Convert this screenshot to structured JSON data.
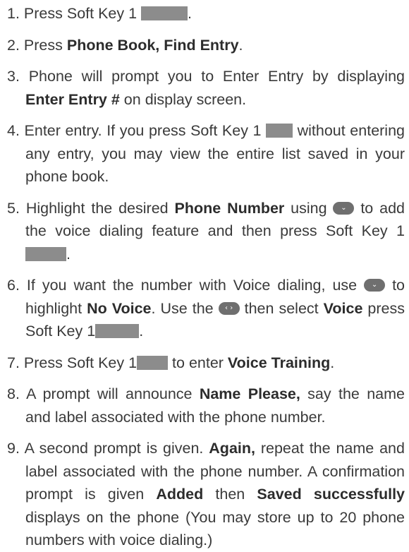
{
  "steps": [
    {
      "num": "1.",
      "parts": [
        {
          "t": "text",
          "v": "Press Soft Key 1 "
        },
        {
          "t": "key",
          "w": "w66"
        },
        {
          "t": "text",
          "v": "."
        }
      ]
    },
    {
      "num": "2.",
      "parts": [
        {
          "t": "text",
          "v": "Press "
        },
        {
          "t": "bold",
          "v": "Phone Book, Find Entry"
        },
        {
          "t": "text",
          "v": "."
        }
      ]
    },
    {
      "num": "3.",
      "parts": [
        {
          "t": "text",
          "v": "Phone will prompt you to Enter Entry by displaying "
        },
        {
          "t": "bold",
          "v": "Enter Entry #"
        },
        {
          "t": "text",
          "v": " on display screen."
        }
      ]
    },
    {
      "num": "4.",
      "parts": [
        {
          "t": "text",
          "v": "Enter entry. If you press Soft Key 1 "
        },
        {
          "t": "key",
          "w": "w38"
        },
        {
          "t": "text",
          "v": " without entering any entry, you may view the entire list saved in your phone book."
        }
      ]
    },
    {
      "num": "5.",
      "parts": [
        {
          "t": "text",
          "v": "Highlight the desired "
        },
        {
          "t": "bold",
          "v": "Phone Number"
        },
        {
          "t": "text",
          "v": " using "
        },
        {
          "t": "nav",
          "icon": "nav-down-icon",
          "glyph": "⌄"
        },
        {
          "t": "text",
          "v": " to add the voice dialing feature and then press Soft Key 1"
        },
        {
          "t": "key",
          "w": "w58"
        },
        {
          "t": "text",
          "v": "."
        }
      ]
    },
    {
      "num": "6.",
      "parts": [
        {
          "t": "text",
          "v": "If you want the number with Voice dialing, use "
        },
        {
          "t": "nav",
          "icon": "nav-down-icon",
          "glyph": "⌄"
        },
        {
          "t": "text",
          "v": " to highlight "
        },
        {
          "t": "bold",
          "v": "No Voice"
        },
        {
          "t": "text",
          "v": ". Use the "
        },
        {
          "t": "nav",
          "icon": "nav-left-right-icon",
          "glyph": "‹ ›"
        },
        {
          "t": "text",
          "v": " then select "
        },
        {
          "t": "bold",
          "v": "Voice"
        },
        {
          "t": "text",
          "v": " press  Soft Key 1"
        },
        {
          "t": "key",
          "w": "w62"
        },
        {
          "t": "text",
          "v": "."
        }
      ]
    },
    {
      "num": "7.",
      "parts": [
        {
          "t": "text",
          "v": "Press Soft Key 1"
        },
        {
          "t": "key",
          "w": "w44"
        },
        {
          "t": "text",
          "v": " to enter "
        },
        {
          "t": "bold",
          "v": "Voice Training"
        },
        {
          "t": "text",
          "v": "."
        }
      ]
    },
    {
      "num": "8.",
      "parts": [
        {
          "t": "text",
          "v": "A prompt will announce "
        },
        {
          "t": "bold",
          "v": "Name Please,"
        },
        {
          "t": "text",
          "v": " say the name and label associated with the phone number."
        }
      ]
    },
    {
      "num": "9.",
      "parts": [
        {
          "t": "text",
          "v": "A second prompt is given. "
        },
        {
          "t": "bold",
          "v": "Again,"
        },
        {
          "t": "text",
          "v": " repeat the name and label associated with the phone number. A confirmation prompt is given "
        },
        {
          "t": "bold",
          "v": "Added"
        },
        {
          "t": "text",
          "v": " then "
        },
        {
          "t": "bold",
          "v": "Saved successfully"
        },
        {
          "t": "text",
          "v": " displays on the phone (You may store up to 20 phone numbers with voice dialing.)"
        }
      ]
    }
  ]
}
